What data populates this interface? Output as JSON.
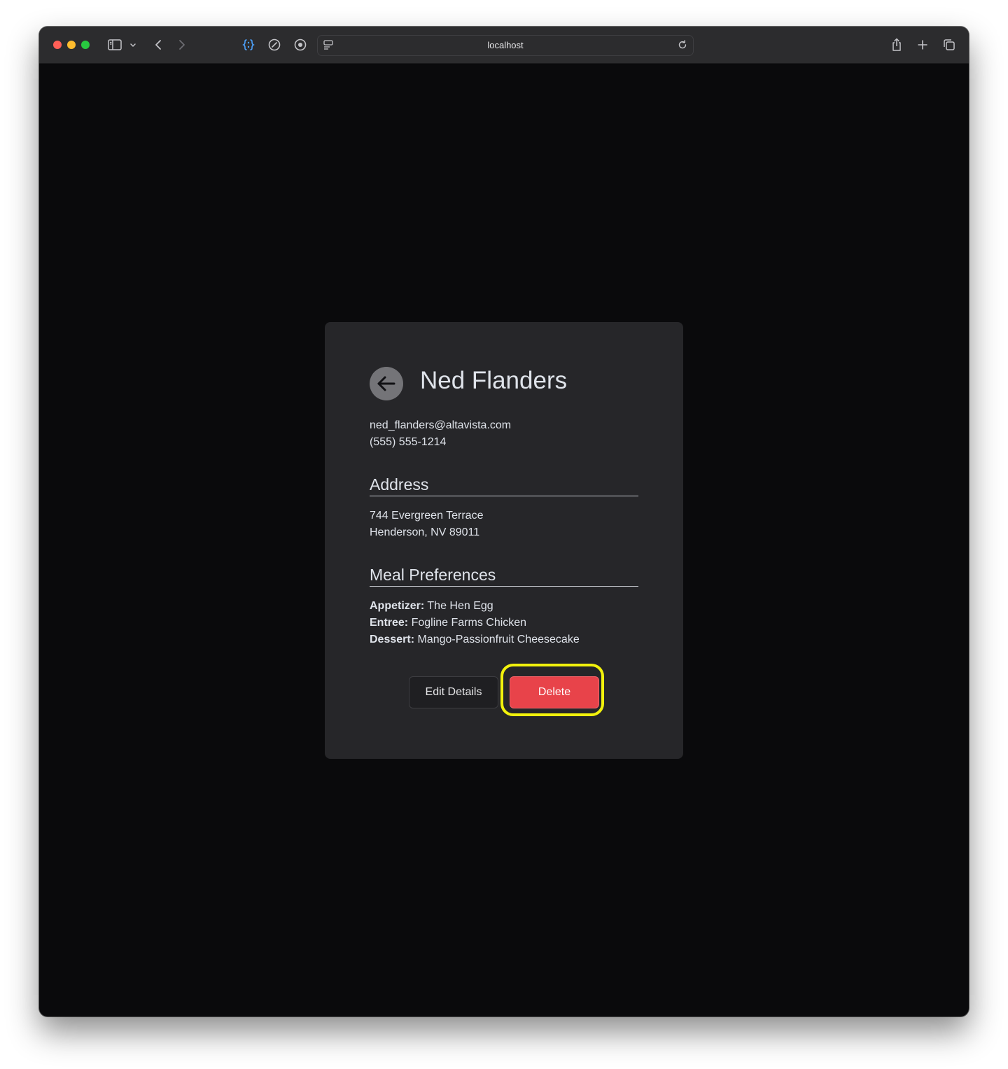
{
  "browser": {
    "url": "localhost",
    "traffic_lights": {
      "close": "#ff5f57",
      "minimize": "#febc2e",
      "zoom": "#28c840"
    }
  },
  "contact": {
    "name": "Ned Flanders",
    "email": "ned_flanders@altavista.com",
    "phone": "(555) 555-1214"
  },
  "address": {
    "heading": "Address",
    "line1": "744 Evergreen Terrace",
    "line2": "Henderson, NV 89011"
  },
  "meals": {
    "heading": "Meal Preferences",
    "items": [
      {
        "label": "Appetizer:",
        "value": "The Hen Egg"
      },
      {
        "label": "Entree:",
        "value": "Fogline Farms Chicken"
      },
      {
        "label": "Dessert:",
        "value": "Mango-Passionfruit Cheesecake"
      }
    ]
  },
  "actions": {
    "edit_label": "Edit Details",
    "delete_label": "Delete",
    "delete_color": "#e8434a",
    "highlight_color": "#f2f20c"
  }
}
